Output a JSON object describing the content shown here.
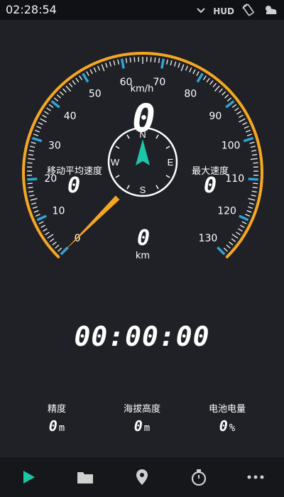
{
  "status_bar": {
    "time": "02:28:54",
    "hud_label": "HUD",
    "icons": [
      "chevron-down-icon",
      "screen-rotate-icon",
      "weather-icon"
    ]
  },
  "speedometer": {
    "unit": "km/h",
    "speed": "0",
    "scale_labels": [
      "0",
      "10",
      "20",
      "30",
      "40",
      "50",
      "60",
      "70",
      "80",
      "90",
      "100",
      "110",
      "120",
      "130"
    ],
    "scale_max": 130,
    "needle_value": 0,
    "accent_color": "#f5a623",
    "tick_color": "#2fa4d8"
  },
  "avg_speed": {
    "label": "移动平均速度",
    "value": "0"
  },
  "max_speed": {
    "label": "最大速度",
    "value": "0"
  },
  "compass": {
    "north": "N",
    "south": "S",
    "east": "E",
    "west": "W",
    "heading_deg": 0,
    "needle_color": "#1cc7a8"
  },
  "distance": {
    "value": "0",
    "unit": "km"
  },
  "timer": "00:00:00",
  "stats": {
    "accuracy": {
      "label": "精度",
      "value": "0",
      "unit": "m"
    },
    "altitude": {
      "label": "海拔高度",
      "value": "0",
      "unit": "m"
    },
    "battery": {
      "label": "电池电量",
      "value": "0",
      "unit": "%"
    }
  },
  "bottom_nav": [
    {
      "name": "play-button",
      "icon": "play-icon"
    },
    {
      "name": "records-button",
      "icon": "folder-icon"
    },
    {
      "name": "location-button",
      "icon": "location-pin-icon"
    },
    {
      "name": "stopwatch-button",
      "icon": "stopwatch-icon"
    },
    {
      "name": "more-button",
      "icon": "more-dots-icon"
    }
  ]
}
